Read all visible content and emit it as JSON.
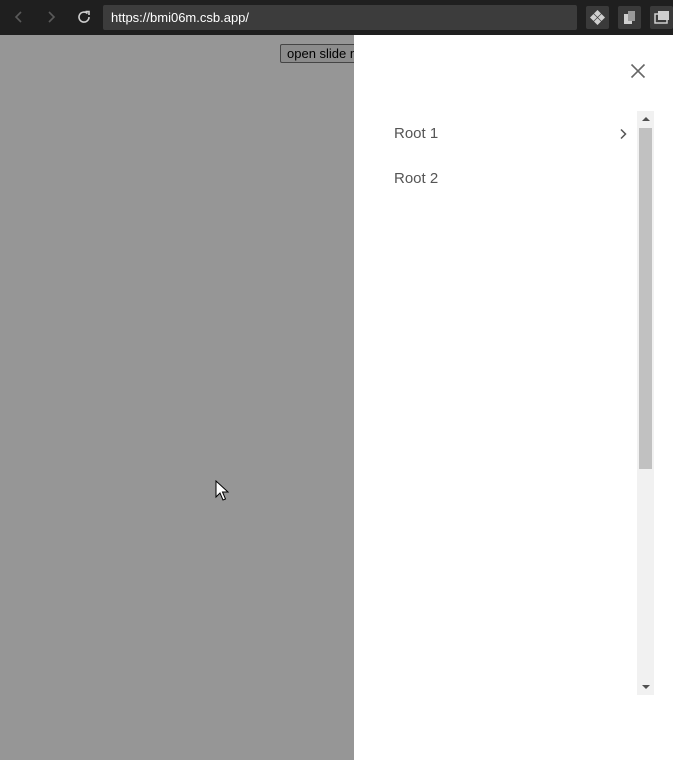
{
  "browser": {
    "url": "https://bmi06m.csb.app/",
    "back_icon": "chevron-left-icon",
    "forward_icon": "chevron-right-icon",
    "reload_icon": "reload-icon",
    "extension_icons": [
      "puzzle-icon",
      "copy-icon",
      "windows-icon"
    ]
  },
  "page": {
    "open_button_label": "open slide menu"
  },
  "drawer": {
    "close_icon": "close-icon",
    "items": [
      {
        "label": "Root 1",
        "has_children": true
      },
      {
        "label": "Root 2",
        "has_children": false
      }
    ]
  },
  "colors": {
    "toolbar_bg": "#1f1f1f",
    "address_bg": "#3c3c3c",
    "overlay": "#999999",
    "drawer_bg": "#ffffff",
    "menu_text": "#555555"
  }
}
